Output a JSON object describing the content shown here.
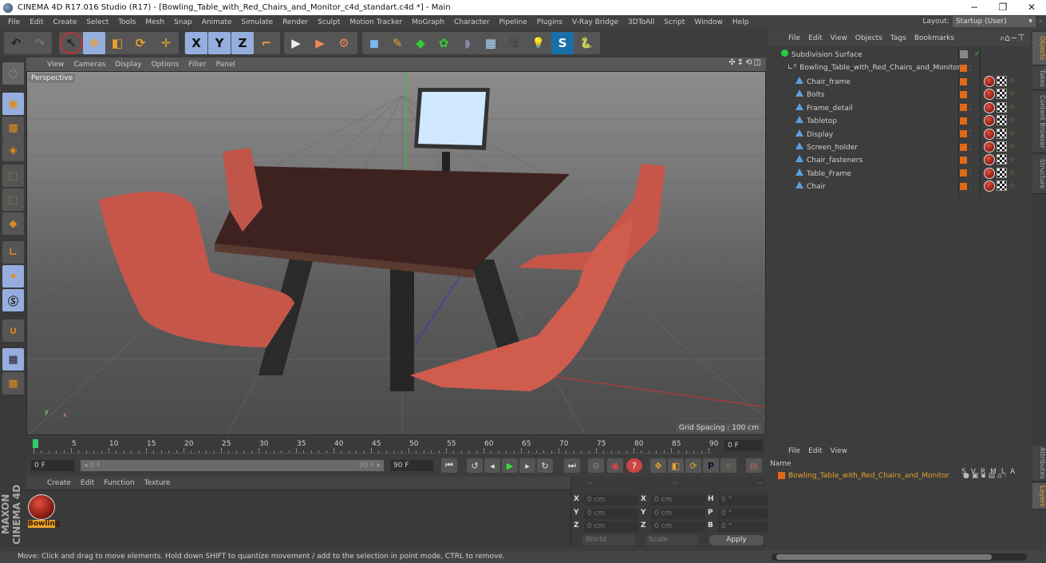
{
  "window": {
    "title": "CINEMA 4D R17.016 Studio (R17) - [Bowling_Table_with_Red_Chairs_and_Monitor_c4d_standart.c4d *] - Main",
    "minimize": "−",
    "maximize": "❐",
    "close": "✕"
  },
  "menubar": {
    "items": [
      "File",
      "Edit",
      "Create",
      "Select",
      "Tools",
      "Mesh",
      "Snap",
      "Animate",
      "Simulate",
      "Render",
      "Sculpt",
      "Motion Tracker",
      "MoGraph",
      "Character",
      "Pipeline",
      "Plugins",
      "V-Ray Bridge",
      "3DToAll",
      "Script",
      "Window",
      "Help"
    ],
    "layout_label": "Layout:",
    "layout_value": "Startup (User)"
  },
  "toolbar": {
    "undo": "↶",
    "redo": "↷",
    "select": "↖",
    "move": "✥",
    "scale": "◧",
    "rotate": "⟳",
    "move2": "✛",
    "x": "X",
    "y": "Y",
    "z": "Z",
    "coord": "⌐",
    "render_view": "▶",
    "render_pv": "▶",
    "render_settings": "⚙",
    "cube": "◼",
    "pen": "✎",
    "subdiv": "◆",
    "array": "✿",
    "deformer": "◗",
    "floor": "▦",
    "camera": "🎥",
    "light": "💡",
    "vray": "S",
    "python": "🐍"
  },
  "viewport": {
    "menu": [
      "View",
      "Cameras",
      "Display",
      "Options",
      "Filter",
      "Panel"
    ],
    "icons": "✣↕⟲◫",
    "label": "Perspective",
    "grid_spacing": "Grid Spacing : 100 cm",
    "axis_y": "y",
    "axis_x": "x"
  },
  "timeline": {
    "ticks": [
      "0",
      "5",
      "10",
      "15",
      "20",
      "25",
      "30",
      "35",
      "40",
      "45",
      "50",
      "55",
      "60",
      "65",
      "70",
      "75",
      "80",
      "85",
      "90"
    ],
    "current_frame": "0 F",
    "start": "0 F",
    "range_start": "◂ 0 F",
    "range_end": "90 F ▸",
    "end": "90 F"
  },
  "playback": {
    "first": "⏮",
    "prev_key": "↺",
    "prev": "◂",
    "play": "▶",
    "next": "▸",
    "next_key": "↻",
    "last": "⏭",
    "record": "⊘",
    "autokey": "◉",
    "help": "?",
    "move": "✥",
    "scale": "◧",
    "rotate": "⟳",
    "param": "P",
    "grid": "⁘",
    "film": "▤"
  },
  "material_manager": {
    "menu": [
      "Create",
      "Edit",
      "Function",
      "Texture"
    ],
    "materials": [
      {
        "name": "Bowling"
      }
    ]
  },
  "coordinates": {
    "header": [
      "--",
      "--",
      "--"
    ],
    "rows": [
      {
        "a": "X",
        "v1": "0 cm",
        "b": "X",
        "v2": "0 cm",
        "c": "H",
        "v3": "0 °"
      },
      {
        "a": "Y",
        "v1": "0 cm",
        "b": "Y",
        "v2": "0 cm",
        "c": "P",
        "v3": "0 °"
      },
      {
        "a": "Z",
        "v1": "0 cm",
        "b": "Z",
        "v2": "0 cm",
        "c": "B",
        "v3": "0 °"
      }
    ],
    "mode": "World",
    "transform": "Scale",
    "apply": "Apply"
  },
  "object_manager": {
    "menu": [
      "File",
      "Edit",
      "View",
      "Objects",
      "Tags",
      "Bookmarks"
    ],
    "root": "Subdivision Surface",
    "group": "Bowling_Table_with_Red_Chairs_and_Monitor",
    "objects": [
      "Chair_frame",
      "Bolts",
      "Frame_detail",
      "Tabletop",
      "Display",
      "Screen_holder",
      "Chair_fasteners",
      "Table_Frame",
      "Chair"
    ]
  },
  "side_tabs": [
    "Objects",
    "Takes",
    "Content Browser",
    "Structure"
  ],
  "side_tabs_bottom": [
    "Attributes",
    "Layers"
  ],
  "layer_manager": {
    "menu": [
      "File",
      "Edit",
      "View"
    ],
    "name_header": "Name",
    "columns": [
      "S",
      "V",
      "R",
      "M",
      "L",
      "A"
    ],
    "layers": [
      "Bowling_Table_with_Red_Chairs_and_Monitor"
    ]
  },
  "maxon": "MAXON CINEMA 4D",
  "status": "Move: Click and drag to move elements. Hold down SHIFT to quantize movement / add to the selection in point mode, CTRL to remove."
}
